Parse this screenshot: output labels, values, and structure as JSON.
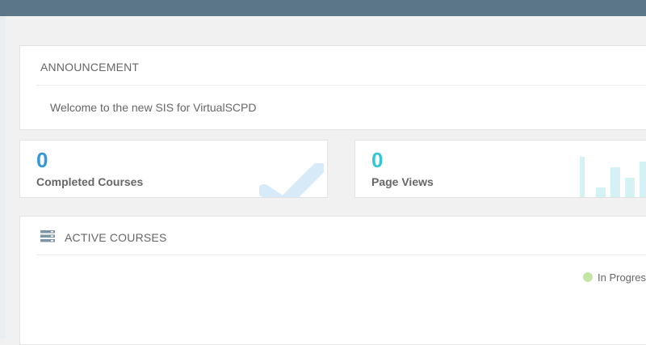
{
  "announcement": {
    "title": "ANNOUNCEMENT",
    "message": "Welcome to the new SIS for VirtualSCPD"
  },
  "stats": {
    "completed": {
      "value": "0",
      "label": "Completed Courses",
      "icon": "check-icon",
      "color": "#3598dc"
    },
    "page_views": {
      "value": "0",
      "label": "Page Views",
      "icon": "bar-chart-icon",
      "color": "#36c6d3"
    }
  },
  "active_courses": {
    "title": "ACTIVE COURSES",
    "icon": "server-icon",
    "legend": {
      "label": "In Progress",
      "color": "#c4e6a4"
    }
  },
  "colors": {
    "topbar": "#5b7687",
    "background": "#f1f1f1"
  }
}
